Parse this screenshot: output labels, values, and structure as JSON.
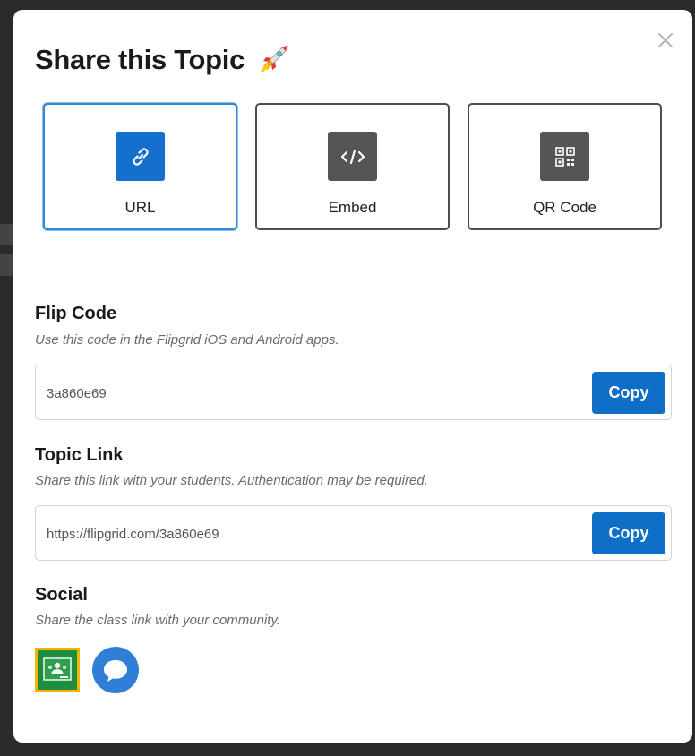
{
  "modal": {
    "title": "Share this Topic",
    "title_emoji_icon": "rocket-icon",
    "close_icon": "close-icon"
  },
  "tabs": [
    {
      "label": "URL",
      "icon": "link-icon",
      "active": true
    },
    {
      "label": "Embed",
      "icon": "code-icon",
      "active": false
    },
    {
      "label": "QR Code",
      "icon": "qr-code-icon",
      "active": false
    }
  ],
  "flip_code": {
    "title": "Flip Code",
    "subtitle": "Use this code in the Flipgrid iOS and Android apps.",
    "value": "3a860e69",
    "copy_label": "Copy"
  },
  "topic_link": {
    "title": "Topic Link",
    "subtitle": "Share this link with your students. Authentication may be required.",
    "value": "https://flipgrid.com/3a860e69",
    "copy_label": "Copy"
  },
  "social": {
    "title": "Social",
    "subtitle": "Share the class link with your community.",
    "items": [
      {
        "icon": "google-classroom-icon"
      },
      {
        "icon": "remind-icon"
      }
    ]
  },
  "colors": {
    "accent": "#0f6ec5",
    "active_border": "#2e86d6",
    "tab_icon_bg": "#555555",
    "classroom_green": "#1e8e3e",
    "classroom_yellow": "#f4b400",
    "remind_blue": "#2f7fd6"
  }
}
